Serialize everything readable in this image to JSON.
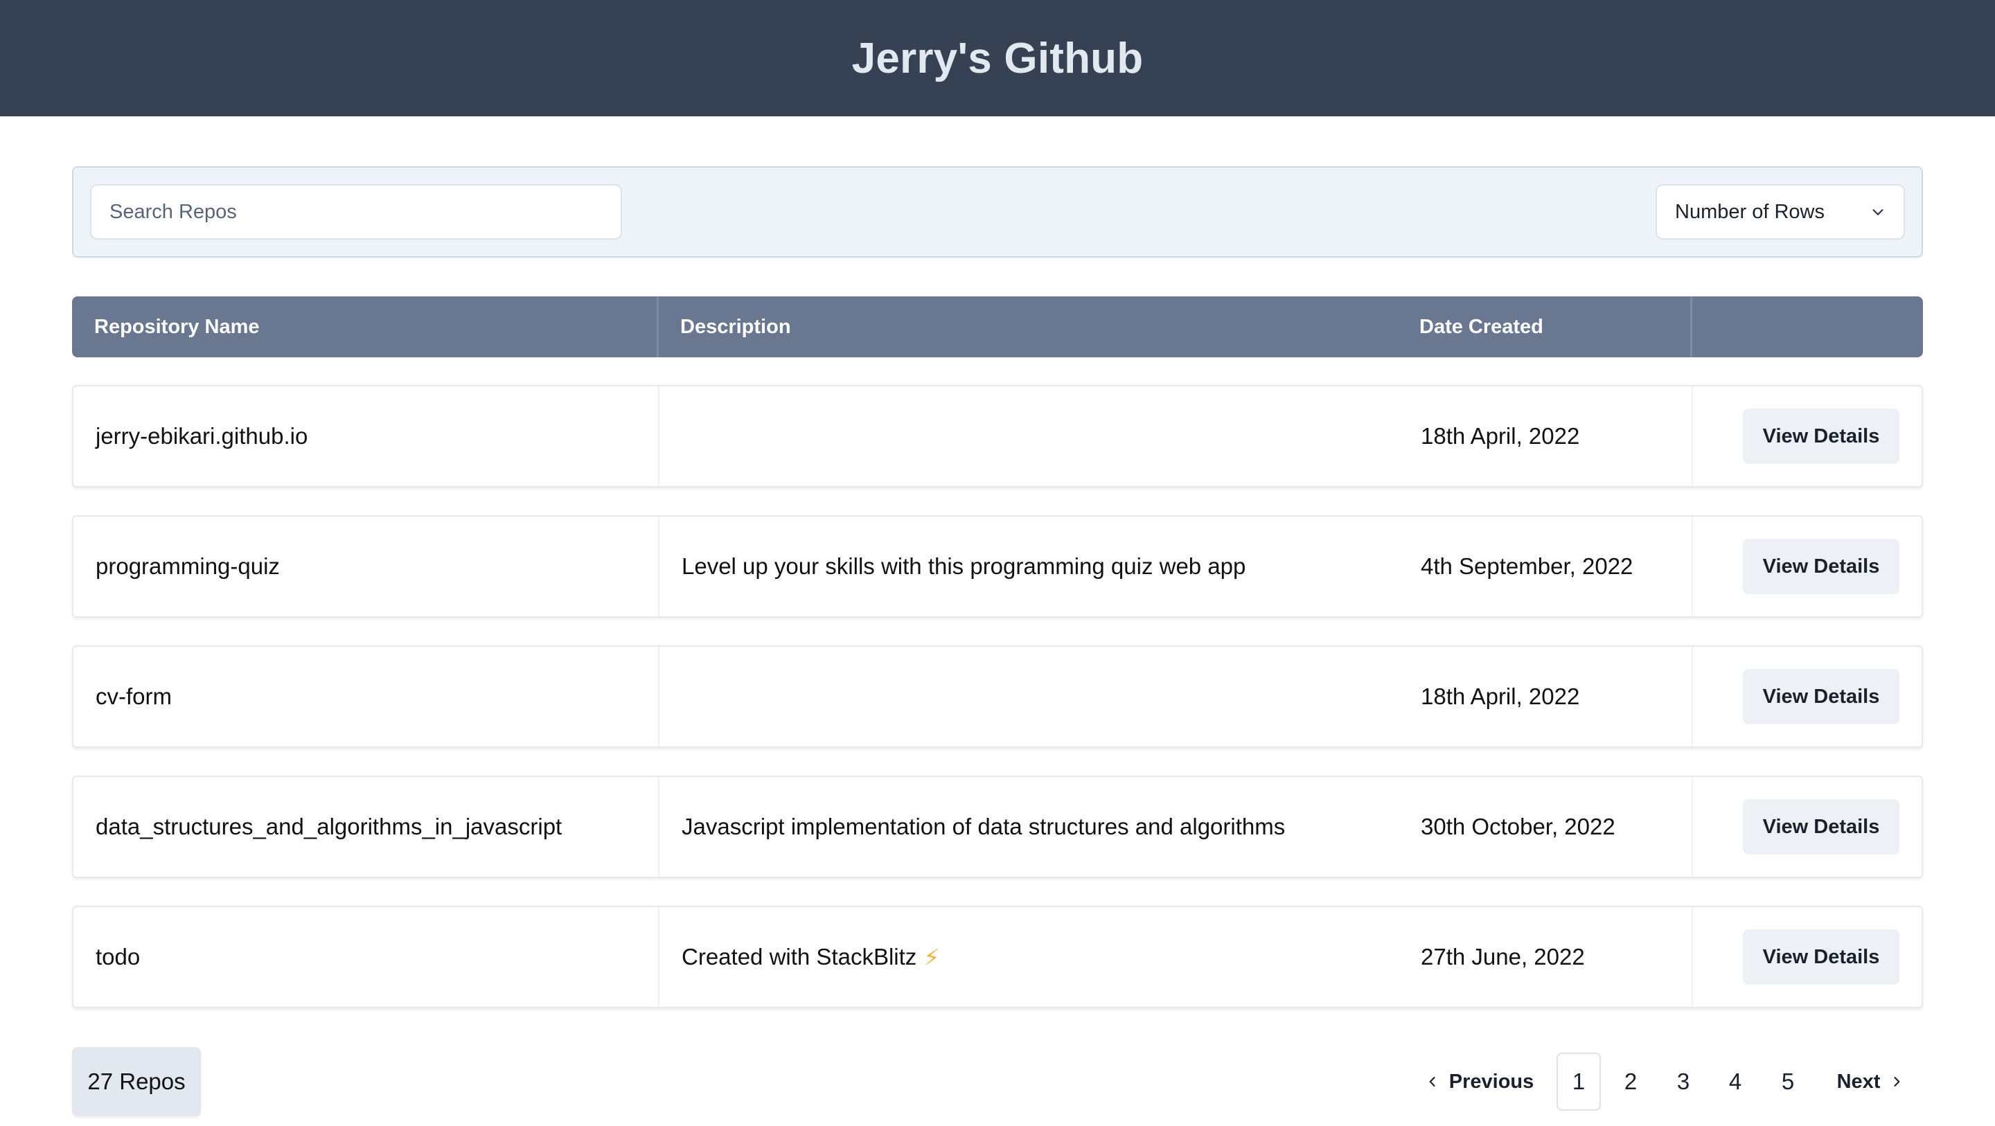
{
  "header": {
    "title": "Jerry's Github"
  },
  "toolbar": {
    "search_placeholder": "Search Repos",
    "rows_select_label": "Number of Rows"
  },
  "table": {
    "columns": [
      "Repository Name",
      "Description",
      "Date Created",
      ""
    ],
    "rows": [
      {
        "name": "jerry-ebikari.github.io",
        "description": "",
        "date": "18th April, 2022",
        "action": "View Details"
      },
      {
        "name": "programming-quiz",
        "description": "Level up your skills with this programming quiz web app",
        "date": "4th September, 2022",
        "action": "View Details"
      },
      {
        "name": "cv-form",
        "description": "",
        "date": "18th April, 2022",
        "action": "View Details"
      },
      {
        "name": "data_structures_and_algorithms_in_javascript",
        "description": "Javascript implementation of data structures and algorithms",
        "date": "30th October, 2022",
        "action": "View Details"
      },
      {
        "name": "todo",
        "description": "Created with StackBlitz",
        "description_emoji": "⚡",
        "date": "27th June, 2022",
        "action": "View Details"
      }
    ]
  },
  "footer": {
    "repo_count": "27 Repos",
    "pagination": {
      "previous": "Previous",
      "next": "Next",
      "pages": [
        "1",
        "2",
        "3",
        "4",
        "5"
      ],
      "current": "1"
    }
  },
  "colors": {
    "header_bg": "#364154",
    "table_head_bg": "#6a7790",
    "toolbar_bg": "#eff4fa",
    "accent_bolt": "#f2b233"
  }
}
